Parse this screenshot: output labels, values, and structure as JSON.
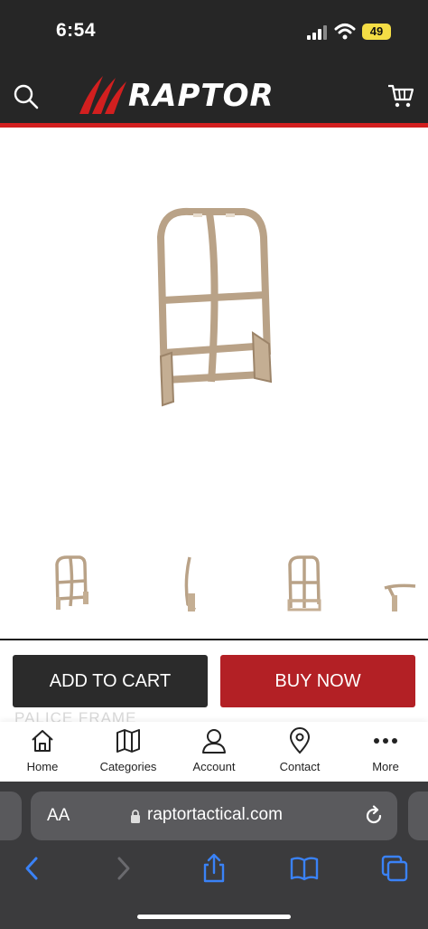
{
  "status": {
    "time": "6:54",
    "battery": "49"
  },
  "header": {
    "brand": "RAPTOR",
    "search_icon": "search-icon",
    "cart_icon": "cart-icon"
  },
  "product": {
    "image": "tan molle frame",
    "obscured_title": "PALICE FRAME"
  },
  "actions": {
    "add_to_cart": "ADD TO CART",
    "buy_now": "BUY NOW"
  },
  "bottom_nav": {
    "items": [
      {
        "label": "Home",
        "icon": "home-icon"
      },
      {
        "label": "Categories",
        "icon": "map-icon"
      },
      {
        "label": "Account",
        "icon": "user-icon"
      },
      {
        "label": "Contact",
        "icon": "location-pin-icon"
      },
      {
        "label": "More",
        "icon": "more-dots-icon"
      }
    ]
  },
  "browser": {
    "text_size": "AA",
    "url": "raptortactical.com"
  },
  "colors": {
    "header_bg": "#262626",
    "accent_red": "#d21f1f",
    "buy_button": "#b32025",
    "cart_button": "#2b2b2b",
    "ios_blue": "#3a82f7"
  }
}
